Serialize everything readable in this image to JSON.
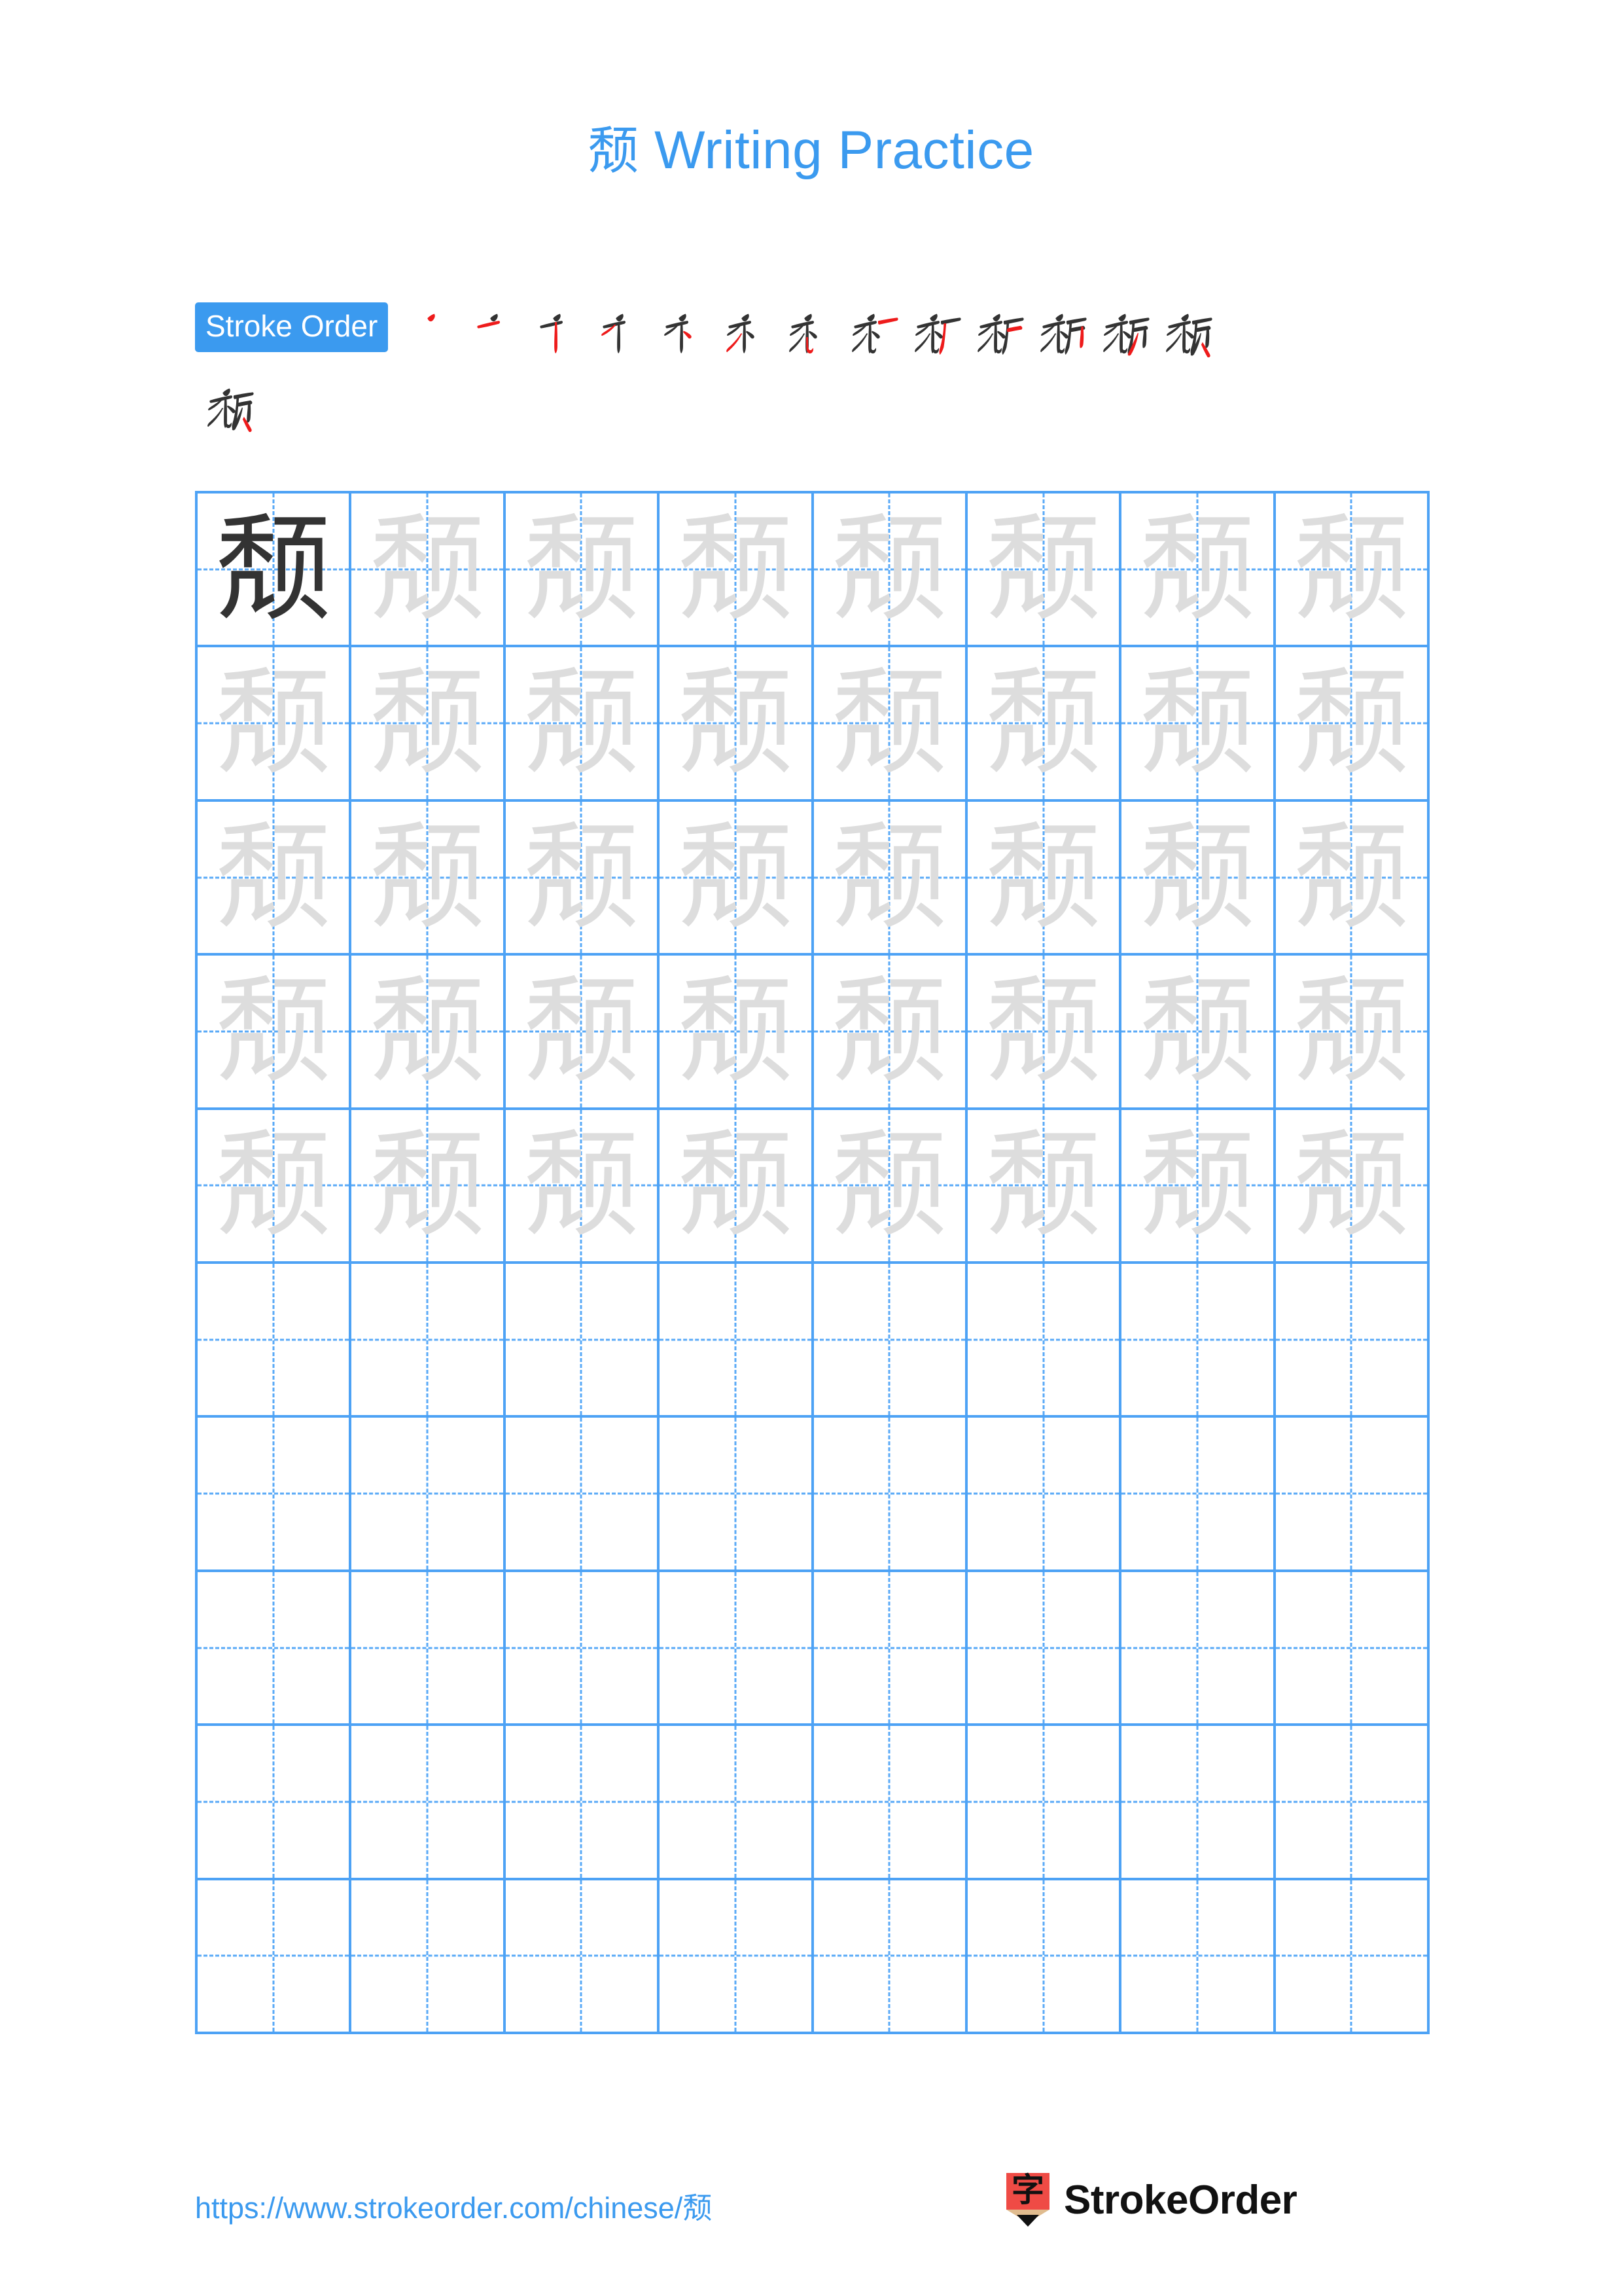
{
  "document": {
    "character": "颓",
    "title_suffix": " Writing Practice",
    "title_full": "颓 Writing Practice"
  },
  "colors": {
    "accent_blue": "#3b9aef",
    "grid_blue": "#4da2f5",
    "guide_blue": "#5aaaf7",
    "new_stroke_red": "#ee1b1b",
    "prev_stroke_gray": "#333333",
    "trace_gray": "#dddddd",
    "logo_red": "#ef4b45",
    "logo_wood": "#e0bc8f",
    "page_background": "#ffffff"
  },
  "stroke_order": {
    "badge_label": "Stroke Order",
    "total_strokes": 13,
    "steps": [
      {
        "index": 1,
        "char": "颓",
        "new_stroke": "丿",
        "description": "stroke-1-pie"
      },
      {
        "index": 2,
        "char": "颓",
        "new_stroke": "一",
        "description": "stroke-2-heng"
      },
      {
        "index": 3,
        "char": "颓",
        "new_stroke": "丨",
        "description": "stroke-3-shu"
      },
      {
        "index": 4,
        "char": "颓",
        "new_stroke": "丿",
        "description": "stroke-4-pie"
      },
      {
        "index": 5,
        "char": "颓",
        "new_stroke": "丶",
        "description": "stroke-5-dian"
      },
      {
        "index": 6,
        "char": "颓",
        "new_stroke": "丿",
        "description": "stroke-6-pie"
      },
      {
        "index": 7,
        "char": "颓",
        "new_stroke": "乚",
        "description": "stroke-7-shuwangou"
      },
      {
        "index": 8,
        "char": "颓",
        "new_stroke": "一",
        "description": "stroke-8-heng"
      },
      {
        "index": 9,
        "char": "颓",
        "new_stroke": "丿",
        "description": "stroke-9-pie"
      },
      {
        "index": 10,
        "char": "颓",
        "new_stroke": "一",
        "description": "stroke-10-hengzhe"
      },
      {
        "index": 11,
        "char": "颓",
        "new_stroke": "丨",
        "description": "stroke-11-shu"
      },
      {
        "index": 12,
        "char": "颓",
        "new_stroke": "丿",
        "description": "stroke-12-pie"
      },
      {
        "index": 13,
        "char": "颓",
        "new_stroke": "丶",
        "description": "stroke-13-dian"
      }
    ],
    "row1_count": 13,
    "row2_count": 1
  },
  "practice_grid": {
    "columns": 8,
    "rows": 10,
    "filled_rows": 5,
    "empty_rows": 5,
    "dark_cells": 1,
    "trace_character": "颓",
    "cells": [
      [
        "dark",
        "light",
        "light",
        "light",
        "light",
        "light",
        "light",
        "light"
      ],
      [
        "light",
        "light",
        "light",
        "light",
        "light",
        "light",
        "light",
        "light"
      ],
      [
        "light",
        "light",
        "light",
        "light",
        "light",
        "light",
        "light",
        "light"
      ],
      [
        "light",
        "light",
        "light",
        "light",
        "light",
        "light",
        "light",
        "light"
      ],
      [
        "light",
        "light",
        "light",
        "light",
        "light",
        "light",
        "light",
        "light"
      ],
      [
        "empty",
        "empty",
        "empty",
        "empty",
        "empty",
        "empty",
        "empty",
        "empty"
      ],
      [
        "empty",
        "empty",
        "empty",
        "empty",
        "empty",
        "empty",
        "empty",
        "empty"
      ],
      [
        "empty",
        "empty",
        "empty",
        "empty",
        "empty",
        "empty",
        "empty",
        "empty"
      ],
      [
        "empty",
        "empty",
        "empty",
        "empty",
        "empty",
        "empty",
        "empty",
        "empty"
      ],
      [
        "empty",
        "empty",
        "empty",
        "empty",
        "empty",
        "empty",
        "empty",
        "empty"
      ]
    ]
  },
  "footer": {
    "url": "https://www.strokeorder.com/chinese/颓",
    "brand_name": "StrokeOrder",
    "logo_glyph": "字"
  }
}
